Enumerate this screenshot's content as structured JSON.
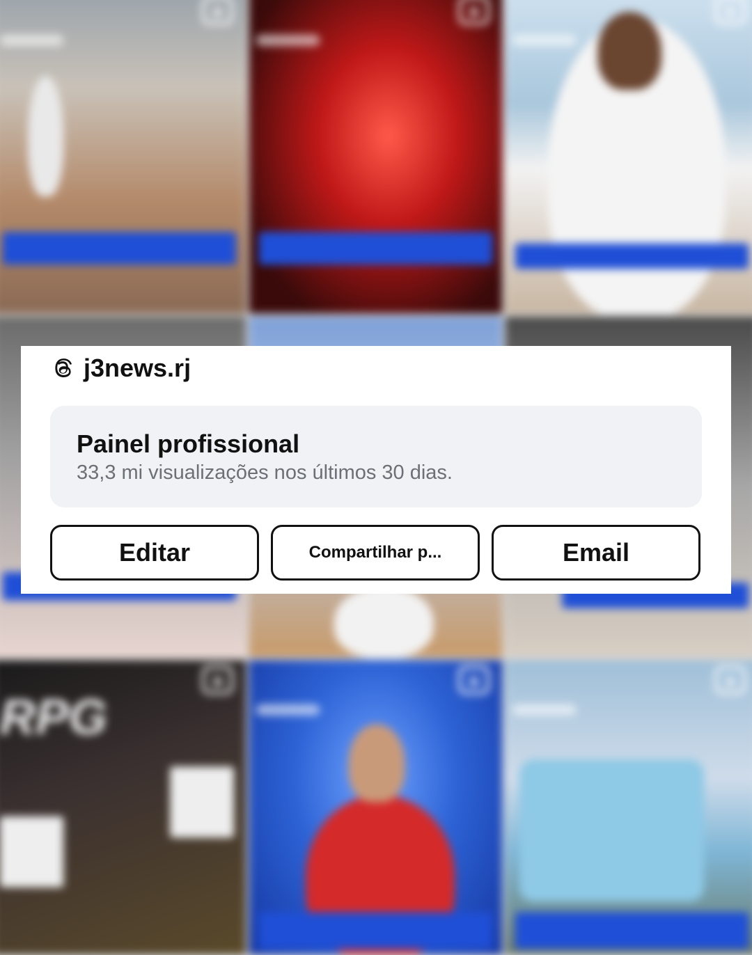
{
  "account": {
    "icon": "threads-icon",
    "username": "j3news.rj"
  },
  "dashboard": {
    "title": "Painel profissional",
    "subtitle": "33,3 mi visualizações nos últimos 30 dias."
  },
  "actions": {
    "edit_label": "Editar",
    "share_label": "Compartilhar p...",
    "email_label": "Email"
  },
  "colors": {
    "caption_blue": "#1f4fd6",
    "panel_bg": "#f1f2f5",
    "text_primary": "#111111",
    "text_secondary": "#6b6f76"
  }
}
